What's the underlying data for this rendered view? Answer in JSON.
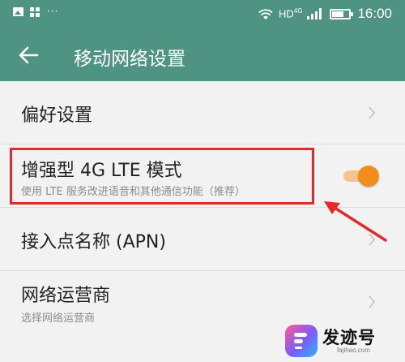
{
  "status_bar": {
    "dots": "···",
    "network_label": "HD",
    "network_superscript": "4G",
    "battery_level": 0.6,
    "time": "16:00"
  },
  "header": {
    "title": "移动网络设置",
    "back_icon": "arrow-left-icon"
  },
  "settings": {
    "items": [
      {
        "title": "偏好设置",
        "subtitle": "",
        "control": "chevron"
      },
      {
        "title": "增强型 4G LTE 模式",
        "subtitle": "使用 LTE 服务改进语音和其他通信功能（推荐）",
        "control": "toggle",
        "enabled": true
      },
      {
        "title": "接入点名称 (APN)",
        "subtitle": "",
        "control": "chevron"
      },
      {
        "title": "网络运营商",
        "subtitle": "选择网络运营商",
        "control": "chevron"
      }
    ]
  },
  "annotation": {
    "highlight_color": "#e02b2b"
  },
  "watermark": {
    "text": "发迹号",
    "url": "fajihao.com"
  },
  "colors": {
    "header": "#4f9383",
    "toggle_on": "#f28c1b",
    "toggle_track_on": "#f7c48e",
    "background": "#f2f2f2"
  }
}
